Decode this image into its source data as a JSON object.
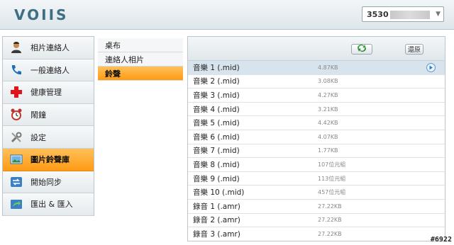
{
  "header": {
    "logo_text": "VOIIS",
    "device": {
      "id_prefix": "3530",
      "caret": "▼"
    }
  },
  "leftnav": {
    "items": [
      {
        "label": "相片連絡人",
        "icon": "contact-photo-icon"
      },
      {
        "label": "一般連絡人",
        "icon": "phone-icon"
      },
      {
        "label": "健康管理",
        "icon": "health-cross-icon"
      },
      {
        "label": "鬧鐘",
        "icon": "alarm-clock-icon"
      },
      {
        "label": "設定",
        "icon": "settings-tools-icon"
      },
      {
        "label": "圖片鈴聲庫",
        "icon": "image-ringtone-icon",
        "active": true
      },
      {
        "label": "開始同步",
        "icon": "sync-icon"
      },
      {
        "label": "匯出 & 匯入",
        "icon": "export-import-icon"
      }
    ]
  },
  "subnav": {
    "items": [
      {
        "label": "桌布"
      },
      {
        "label": "連絡人相片"
      },
      {
        "label": "鈴聲",
        "active": true
      }
    ]
  },
  "toolbar": {
    "sync_icon": "sync-arrows-icon",
    "restore_label": "還原"
  },
  "files": [
    {
      "name": "音樂 1 (.mid)",
      "size": "4.87KB",
      "selected": true,
      "play_icon": "play-icon"
    },
    {
      "name": "音樂 2 (.mid)",
      "size": "3.08KB"
    },
    {
      "name": "音樂 3 (.mid)",
      "size": "4.27KB"
    },
    {
      "name": "音樂 4 (.mid)",
      "size": "3.21KB"
    },
    {
      "name": "音樂 5 (.mid)",
      "size": "4.42KB"
    },
    {
      "name": "音樂 6 (.mid)",
      "size": "4.07KB"
    },
    {
      "name": "音樂 7 (.mid)",
      "size": "1.77KB"
    },
    {
      "name": "音樂 8 (.mid)",
      "size": "107位元組"
    },
    {
      "name": "音樂 9 (.mid)",
      "size": "113位元組"
    },
    {
      "name": "音樂 10 (.mid)",
      "size": "457位元組"
    },
    {
      "name": "錄音 1 (.amr)",
      "size": "27.22KB"
    },
    {
      "name": "錄音 2 (.amr)",
      "size": "27.22KB"
    },
    {
      "name": "錄音 3 (.amr)",
      "size": "27.22KB"
    }
  ],
  "watermark": "#6922",
  "colors": {
    "accent_orange": "#ff9a14",
    "selected_row": "#d7e4ee",
    "brand_blue": "#3f6e84"
  }
}
